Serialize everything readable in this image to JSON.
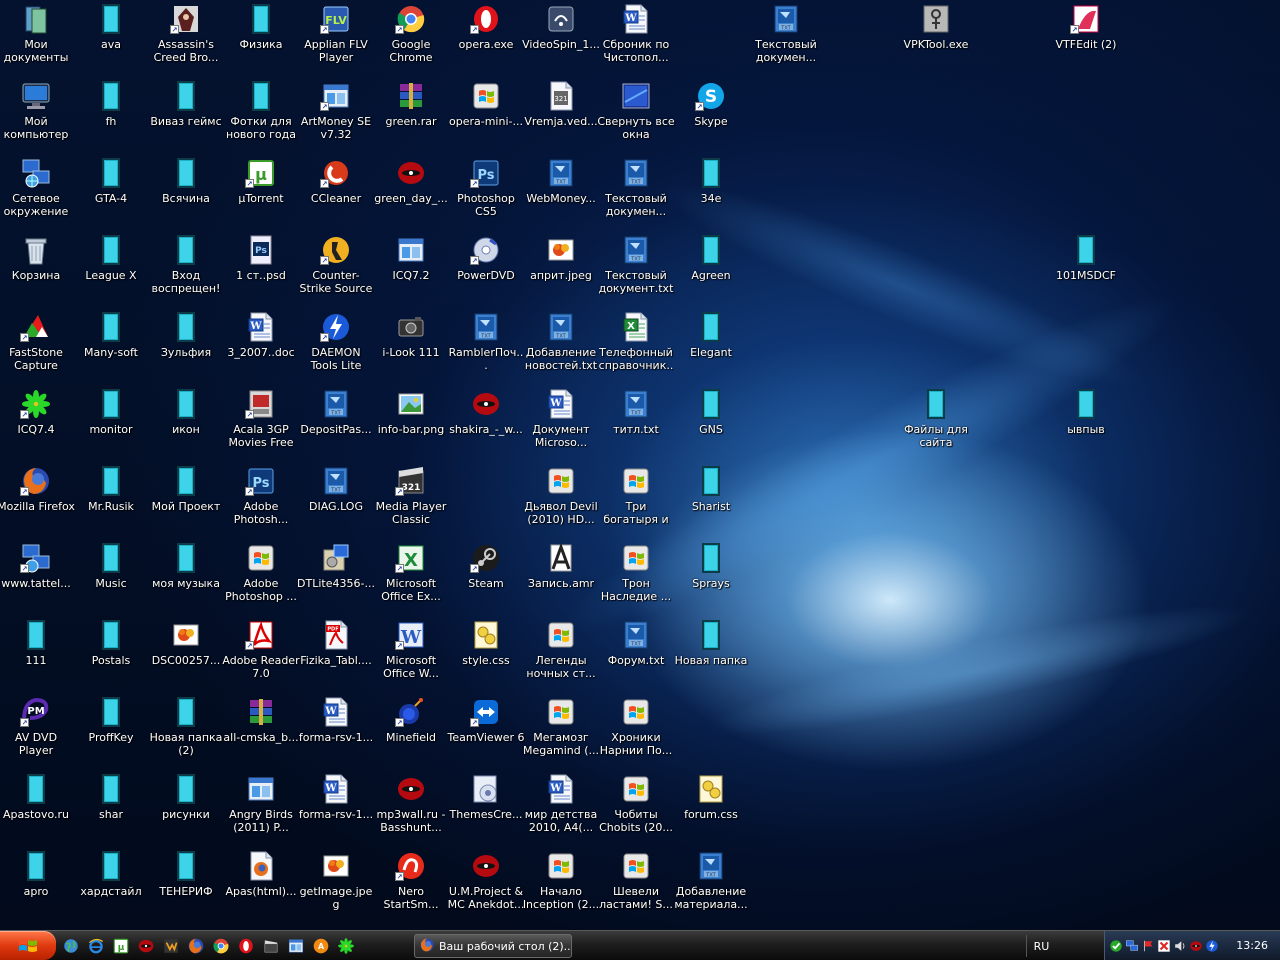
{
  "desktop": {
    "icons": [
      {
        "label": "Мои документы",
        "icon": "my-documents",
        "col": 0,
        "row": 0,
        "shortcut": false
      },
      {
        "label": "ava",
        "icon": "folder",
        "col": 1,
        "row": 0,
        "shortcut": false
      },
      {
        "label": "Assassin's Creed Bro...",
        "icon": "assassins-creed",
        "col": 2,
        "row": 0,
        "shortcut": true
      },
      {
        "label": "Физика",
        "icon": "folder",
        "col": 3,
        "row": 0,
        "shortcut": false
      },
      {
        "label": "Applian FLV Player",
        "icon": "flv-player",
        "col": 4,
        "row": 0,
        "shortcut": true
      },
      {
        "label": "Google Chrome",
        "icon": "chrome",
        "col": 5,
        "row": 0,
        "shortcut": true
      },
      {
        "label": "opera.exe",
        "icon": "opera",
        "col": 6,
        "row": 0,
        "shortcut": true
      },
      {
        "label": "VideoSpin_1...",
        "icon": "videospin",
        "col": 7,
        "row": 0,
        "shortcut": false
      },
      {
        "label": "Сброник по Чистопол...",
        "icon": "word-doc",
        "col": 8,
        "row": 0,
        "shortcut": false
      },
      {
        "label": "Текстовый докумен...",
        "icon": "txt-file",
        "col": 10,
        "row": 0,
        "shortcut": false
      },
      {
        "label": "VPKTool.exe",
        "icon": "vpktool",
        "col": 12,
        "row": 0,
        "shortcut": false
      },
      {
        "label": "VTFEdit (2)",
        "icon": "vtfedit",
        "col": 14,
        "row": 0,
        "shortcut": true
      },
      {
        "label": "Мой компьютер",
        "icon": "my-computer",
        "col": 0,
        "row": 1,
        "shortcut": false
      },
      {
        "label": "fh",
        "icon": "folder",
        "col": 1,
        "row": 1,
        "shortcut": false
      },
      {
        "label": "Виваз геймс",
        "icon": "folder",
        "col": 2,
        "row": 1,
        "shortcut": false
      },
      {
        "label": "Фотки для нового года",
        "icon": "folder",
        "col": 3,
        "row": 1,
        "shortcut": false
      },
      {
        "label": "ArtMoney SE v7.32",
        "icon": "window-app",
        "col": 4,
        "row": 1,
        "shortcut": true
      },
      {
        "label": "green.rar",
        "icon": "winrar",
        "col": 5,
        "row": 1,
        "shortcut": false
      },
      {
        "label": "opera-mini-...",
        "icon": "windows-file",
        "col": 6,
        "row": 1,
        "shortcut": false
      },
      {
        "label": "Vremja.ved...",
        "icon": "media-file",
        "col": 7,
        "row": 1,
        "shortcut": false
      },
      {
        "label": "Свернуть все окна",
        "icon": "show-desktop",
        "col": 8,
        "row": 1,
        "shortcut": false
      },
      {
        "label": "Skype",
        "icon": "skype",
        "col": 9,
        "row": 1,
        "shortcut": true
      },
      {
        "label": "Сетевое окружение",
        "icon": "network",
        "col": 0,
        "row": 2,
        "shortcut": false
      },
      {
        "label": "GTA-4",
        "icon": "folder",
        "col": 1,
        "row": 2,
        "shortcut": false
      },
      {
        "label": "Всячина",
        "icon": "folder",
        "col": 2,
        "row": 2,
        "shortcut": false
      },
      {
        "label": "µTorrent",
        "icon": "utorrent",
        "col": 3,
        "row": 2,
        "shortcut": true
      },
      {
        "label": "CCleaner",
        "icon": "ccleaner",
        "col": 4,
        "row": 2,
        "shortcut": true
      },
      {
        "label": "green_day_...",
        "icon": "red-disc",
        "col": 5,
        "row": 2,
        "shortcut": false
      },
      {
        "label": "Photoshop CS5",
        "icon": "photoshop",
        "col": 6,
        "row": 2,
        "shortcut": true
      },
      {
        "label": "WebMoney...",
        "icon": "txt-file",
        "col": 7,
        "row": 2,
        "shortcut": false
      },
      {
        "label": "Текстовый докумен...",
        "icon": "txt-file",
        "col": 8,
        "row": 2,
        "shortcut": false
      },
      {
        "label": "34е",
        "icon": "folder",
        "col": 9,
        "row": 2,
        "shortcut": false
      },
      {
        "label": "Корзина",
        "icon": "recycle-bin",
        "col": 0,
        "row": 3,
        "shortcut": false
      },
      {
        "label": "League X",
        "icon": "folder",
        "col": 1,
        "row": 3,
        "shortcut": false
      },
      {
        "label": "Вход воспрещен!",
        "icon": "folder",
        "col": 2,
        "row": 3,
        "shortcut": false
      },
      {
        "label": "1 ст..psd",
        "icon": "psd-file",
        "col": 3,
        "row": 3,
        "shortcut": false
      },
      {
        "label": "Counter-Strike Source",
        "icon": "counter-strike",
        "col": 4,
        "row": 3,
        "shortcut": true
      },
      {
        "label": "ICQ7.2",
        "icon": "window-app",
        "col": 5,
        "row": 3,
        "shortcut": false
      },
      {
        "label": "PowerDVD",
        "icon": "powerdvd",
        "col": 6,
        "row": 3,
        "shortcut": true
      },
      {
        "label": "априт.jpeg",
        "icon": "image-file",
        "col": 7,
        "row": 3,
        "shortcut": false
      },
      {
        "label": "Текстовый документ.txt",
        "icon": "txt-file",
        "col": 8,
        "row": 3,
        "shortcut": false
      },
      {
        "label": "Agreen",
        "icon": "folder",
        "col": 9,
        "row": 3,
        "shortcut": false
      },
      {
        "label": "101MSDCF",
        "icon": "folder",
        "col": 14,
        "row": 3,
        "shortcut": false
      },
      {
        "label": "FastStone Capture",
        "icon": "faststone",
        "col": 0,
        "row": 4,
        "shortcut": true
      },
      {
        "label": "Many-soft",
        "icon": "folder",
        "col": 1,
        "row": 4,
        "shortcut": false
      },
      {
        "label": "Зульфия",
        "icon": "folder",
        "col": 2,
        "row": 4,
        "shortcut": false
      },
      {
        "label": "3_2007..doc",
        "icon": "word-doc",
        "col": 3,
        "row": 4,
        "shortcut": false
      },
      {
        "label": "DAEMON Tools Lite",
        "icon": "daemon-tools",
        "col": 4,
        "row": 4,
        "shortcut": true
      },
      {
        "label": "i-Look 111",
        "icon": "camera",
        "col": 5,
        "row": 4,
        "shortcut": false
      },
      {
        "label": "RamblerПоч...",
        "icon": "txt-file",
        "col": 6,
        "row": 4,
        "shortcut": false
      },
      {
        "label": "Добавление новостей.txt",
        "icon": "txt-file",
        "col": 7,
        "row": 4,
        "shortcut": false
      },
      {
        "label": "Телефонный справочник...",
        "icon": "excel-doc",
        "col": 8,
        "row": 4,
        "shortcut": false
      },
      {
        "label": "Elegant",
        "icon": "folder",
        "col": 9,
        "row": 4,
        "shortcut": false
      },
      {
        "label": "ICQ7.4",
        "icon": "icq",
        "col": 0,
        "row": 5,
        "shortcut": true
      },
      {
        "label": "monitor",
        "icon": "folder",
        "col": 1,
        "row": 5,
        "shortcut": false
      },
      {
        "label": "икон",
        "icon": "folder",
        "col": 2,
        "row": 5,
        "shortcut": false
      },
      {
        "label": "Acala 3GP Movies Free",
        "icon": "acala",
        "col": 3,
        "row": 5,
        "shortcut": true
      },
      {
        "label": "DepositPas...",
        "icon": "txt-file",
        "col": 4,
        "row": 5,
        "shortcut": false
      },
      {
        "label": "info-bar.png",
        "icon": "png-file",
        "col": 5,
        "row": 5,
        "shortcut": false
      },
      {
        "label": "shakira_-_w...",
        "icon": "red-disc",
        "col": 6,
        "row": 5,
        "shortcut": false
      },
      {
        "label": "Документ Microso...",
        "icon": "word-doc",
        "col": 7,
        "row": 5,
        "shortcut": false
      },
      {
        "label": "титл.txt",
        "icon": "txt-file",
        "col": 8,
        "row": 5,
        "shortcut": false
      },
      {
        "label": "GNS",
        "icon": "folder",
        "col": 9,
        "row": 5,
        "shortcut": false
      },
      {
        "label": "Файлы для сайта",
        "icon": "folder",
        "col": 12,
        "row": 5,
        "shortcut": false
      },
      {
        "label": "ывпыв",
        "icon": "folder",
        "col": 14,
        "row": 5,
        "shortcut": false
      },
      {
        "label": "Mozilla Firefox",
        "icon": "firefox",
        "col": 0,
        "row": 6,
        "shortcut": true
      },
      {
        "label": "Mr.Rusik",
        "icon": "folder",
        "col": 1,
        "row": 6,
        "shortcut": false
      },
      {
        "label": "Мой Проект",
        "icon": "folder",
        "col": 2,
        "row": 6,
        "shortcut": false
      },
      {
        "label": "Adobe Photosh...",
        "icon": "photoshop",
        "col": 3,
        "row": 6,
        "shortcut": true
      },
      {
        "label": "DIAG.LOG",
        "icon": "txt-file",
        "col": 4,
        "row": 6,
        "shortcut": false
      },
      {
        "label": "Media Player Classic",
        "icon": "media-player-classic",
        "col": 5,
        "row": 6,
        "shortcut": true
      },
      {
        "label": "Дьявол Devil (2010) HD...",
        "icon": "windows-file",
        "col": 7,
        "row": 6,
        "shortcut": false
      },
      {
        "label": "Три богатыря и Шамахан...",
        "icon": "windows-file",
        "col": 8,
        "row": 6,
        "shortcut": false
      },
      {
        "label": "Sharist",
        "icon": "folder",
        "col": 9,
        "row": 6,
        "shortcut": false
      },
      {
        "label": "www.tattel...",
        "icon": "network-shortcut",
        "col": 0,
        "row": 7,
        "shortcut": true
      },
      {
        "label": "Music",
        "icon": "folder",
        "col": 1,
        "row": 7,
        "shortcut": false
      },
      {
        "label": "моя музыка",
        "icon": "folder",
        "col": 2,
        "row": 7,
        "shortcut": false
      },
      {
        "label": "Adobe Photoshop ...",
        "icon": "windows-file",
        "col": 3,
        "row": 7,
        "shortcut": false
      },
      {
        "label": "DTLite4356-...",
        "icon": "installer",
        "col": 4,
        "row": 7,
        "shortcut": false
      },
      {
        "label": "Microsoft Office Ex...",
        "icon": "excel-app",
        "col": 5,
        "row": 7,
        "shortcut": true
      },
      {
        "label": "Steam",
        "icon": "steam",
        "col": 6,
        "row": 7,
        "shortcut": true
      },
      {
        "label": "Запись.amr",
        "icon": "amr-file",
        "col": 7,
        "row": 7,
        "shortcut": false
      },
      {
        "label": "Трон Наследие ...",
        "icon": "windows-file",
        "col": 8,
        "row": 7,
        "shortcut": false
      },
      {
        "label": "Sprays",
        "icon": "folder",
        "col": 9,
        "row": 7,
        "shortcut": false
      },
      {
        "label": "111",
        "icon": "folder",
        "col": 0,
        "row": 8,
        "shortcut": false
      },
      {
        "label": "Postals",
        "icon": "folder",
        "col": 1,
        "row": 8,
        "shortcut": false
      },
      {
        "label": "DSC00257...",
        "icon": "image-file",
        "col": 2,
        "row": 8,
        "shortcut": false
      },
      {
        "label": "Adobe Reader 7.0",
        "icon": "adobe-reader",
        "col": 3,
        "row": 8,
        "shortcut": true
      },
      {
        "label": "Fizika_Tabl....",
        "icon": "pdf-file",
        "col": 4,
        "row": 8,
        "shortcut": false
      },
      {
        "label": "Microsoft Office W...",
        "icon": "word-app",
        "col": 5,
        "row": 8,
        "shortcut": true
      },
      {
        "label": "style.css",
        "icon": "css-file",
        "col": 6,
        "row": 8,
        "shortcut": false
      },
      {
        "label": "Легенды ночных ст...",
        "icon": "windows-file",
        "col": 7,
        "row": 8,
        "shortcut": false
      },
      {
        "label": "Форум.txt",
        "icon": "txt-file",
        "col": 8,
        "row": 8,
        "shortcut": false
      },
      {
        "label": "Новая папка",
        "icon": "folder",
        "col": 9,
        "row": 8,
        "shortcut": false
      },
      {
        "label": "AV DVD Player Morpher",
        "icon": "av-dvd",
        "col": 0,
        "row": 9,
        "shortcut": true
      },
      {
        "label": "ProffKey",
        "icon": "folder",
        "col": 1,
        "row": 9,
        "shortcut": false
      },
      {
        "label": "Новая папка (2)",
        "icon": "folder",
        "col": 2,
        "row": 9,
        "shortcut": false
      },
      {
        "label": "all-cmska_b...",
        "icon": "winrar",
        "col": 3,
        "row": 9,
        "shortcut": false
      },
      {
        "label": "forma-rsv-1...",
        "icon": "word-doc",
        "col": 4,
        "row": 9,
        "shortcut": false
      },
      {
        "label": "Minefield",
        "icon": "minefield",
        "col": 5,
        "row": 9,
        "shortcut": true
      },
      {
        "label": "TeamViewer 6",
        "icon": "teamviewer",
        "col": 6,
        "row": 9,
        "shortcut": true
      },
      {
        "label": "Мегамозг Megamind (...",
        "icon": "windows-file",
        "col": 7,
        "row": 9,
        "shortcut": false
      },
      {
        "label": "Хроники Нарнии По...",
        "icon": "windows-file",
        "col": 8,
        "row": 9,
        "shortcut": false
      },
      {
        "label": "Apastovo.ru",
        "icon": "folder",
        "col": 0,
        "row": 10,
        "shortcut": false
      },
      {
        "label": "shar",
        "icon": "folder",
        "col": 1,
        "row": 10,
        "shortcut": false
      },
      {
        "label": "рисунки",
        "icon": "folder",
        "col": 2,
        "row": 10,
        "shortcut": false
      },
      {
        "label": "Angry Birds (2011) P...",
        "icon": "window-app",
        "col": 3,
        "row": 10,
        "shortcut": false
      },
      {
        "label": "forma-rsv-1...",
        "icon": "word-doc",
        "col": 4,
        "row": 10,
        "shortcut": false
      },
      {
        "label": "mp3wall.ru - Basshunt...",
        "icon": "red-disc",
        "col": 5,
        "row": 10,
        "shortcut": false
      },
      {
        "label": "ThemesCre...",
        "icon": "themes-creator",
        "col": 6,
        "row": 10,
        "shortcut": false
      },
      {
        "label": "мир детства 2010, A4(...",
        "icon": "word-doc",
        "col": 7,
        "row": 10,
        "shortcut": false
      },
      {
        "label": "Чобиты Chobits (20...",
        "icon": "windows-file",
        "col": 8,
        "row": 10,
        "shortcut": false
      },
      {
        "label": "forum.css",
        "icon": "css-file",
        "col": 9,
        "row": 10,
        "shortcut": false
      },
      {
        "label": "apro",
        "icon": "folder",
        "col": 0,
        "row": 11,
        "shortcut": false
      },
      {
        "label": "хардстайл",
        "icon": "folder",
        "col": 1,
        "row": 11,
        "shortcut": false
      },
      {
        "label": "ТЕНЕРИФ",
        "icon": "folder",
        "col": 2,
        "row": 11,
        "shortcut": false
      },
      {
        "label": "Apas(html)...",
        "icon": "firefox-doc",
        "col": 3,
        "row": 11,
        "shortcut": false
      },
      {
        "label": "getImage.jpeg",
        "icon": "image-file",
        "col": 4,
        "row": 11,
        "shortcut": false
      },
      {
        "label": "Nero StartSm...",
        "icon": "nero",
        "col": 5,
        "row": 11,
        "shortcut": true
      },
      {
        "label": "U.M.Project & MC Anekdot...",
        "icon": "red-disc",
        "col": 6,
        "row": 11,
        "shortcut": false
      },
      {
        "label": "Начало Inception (2...",
        "icon": "windows-file",
        "col": 7,
        "row": 11,
        "shortcut": false
      },
      {
        "label": "Шевели ластами! S...",
        "icon": "windows-file",
        "col": 8,
        "row": 11,
        "shortcut": false
      },
      {
        "label": "Добавление материала...",
        "icon": "txt-file",
        "col": 9,
        "row": 11,
        "shortcut": false
      }
    ]
  },
  "taskbar": {
    "quicklaunch": [
      {
        "icon": "globe"
      },
      {
        "icon": "ie"
      },
      {
        "icon": "utorrent"
      },
      {
        "icon": "red-disc"
      },
      {
        "icon": "winamp"
      },
      {
        "icon": "firefox"
      },
      {
        "icon": "chrome"
      },
      {
        "icon": "opera"
      },
      {
        "icon": "clapper"
      },
      {
        "icon": "window-app"
      },
      {
        "icon": "avast"
      },
      {
        "icon": "icq"
      }
    ],
    "task": {
      "label": "Ваш рабочий стол (2)...",
      "icon": "firefox"
    },
    "language": "RU",
    "tray": [
      {
        "icon": "green-check"
      },
      {
        "icon": "network-monitors"
      },
      {
        "icon": "flag"
      },
      {
        "icon": "red-x"
      },
      {
        "icon": "speaker"
      },
      {
        "icon": "red-disc"
      },
      {
        "icon": "daemon-tools"
      }
    ],
    "clock": "13:26"
  }
}
